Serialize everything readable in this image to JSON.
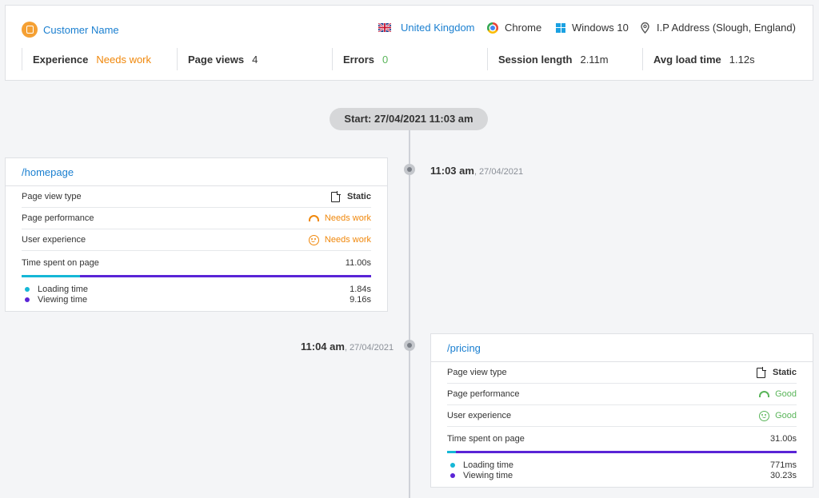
{
  "customer": {
    "name": "Customer Name"
  },
  "meta": {
    "country": "United Kingdom",
    "browser": "Chrome",
    "os": "Windows 10",
    "ip": "I.P Address (Slough, England)"
  },
  "stats": {
    "experience": {
      "label": "Experience",
      "value": "Needs work",
      "color": "#f0870a"
    },
    "page_views": {
      "label": "Page views",
      "value": "4"
    },
    "errors": {
      "label": "Errors",
      "value": "0",
      "color": "#5ab55a"
    },
    "session_length": {
      "label": "Session length",
      "value": "2.11m"
    },
    "avg_load": {
      "label": "Avg load time",
      "value": "1.12s"
    }
  },
  "timeline": {
    "start": "Start: 27/04/2021 11:03 am",
    "events": [
      {
        "time": "11:03 am",
        "date": ", 27/04/2021",
        "path": "/homepage",
        "view_type_label": "Page view type",
        "view_type": "Static",
        "perf_label": "Page performance",
        "perf": "Needs work",
        "ux_label": "User experience",
        "ux": "Needs work",
        "time_label": "Time spent on page",
        "time_spent": "11.00s",
        "loading_label": "Loading time",
        "loading": "1.84s",
        "viewing_label": "Viewing time",
        "viewing": "9.16s",
        "loading_fraction": 0.167
      },
      {
        "time": "11:04 am",
        "date": ", 27/04/2021",
        "path": "/pricing",
        "view_type_label": "Page view type",
        "view_type": "Static",
        "perf_label": "Page performance",
        "perf": "Good",
        "ux_label": "User experience",
        "ux": "Good",
        "time_label": "Time spent on page",
        "time_spent": "31.00s",
        "loading_label": "Loading time",
        "loading": "771ms",
        "viewing_label": "Viewing time",
        "viewing": "30.23s",
        "loading_fraction": 0.025
      }
    ]
  },
  "colors": {
    "link": "#1a7fd0",
    "warn": "#f0870a",
    "good": "#5ab55a",
    "loading": "#15b7d6",
    "viewing": "#5a24d6"
  }
}
